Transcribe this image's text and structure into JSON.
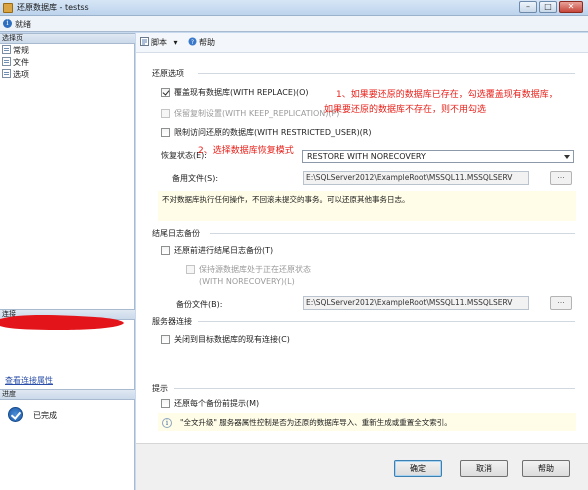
{
  "window": {
    "title": "还原数据库 - testss",
    "controls": [
      "–",
      "□",
      "✕"
    ]
  },
  "status": {
    "text": "就绪"
  },
  "left": {
    "select_page_header": "选择页",
    "pages": [
      "常规",
      "文件",
      "选项"
    ],
    "connection_header": "连接",
    "view_connection_props": "查看连接属性",
    "progress_header": "进度",
    "progress_status": "已完成"
  },
  "toolbar": {
    "script_label": "脚本",
    "help_label": "帮助"
  },
  "restore_options": {
    "header": "还原选项",
    "overwrite": {
      "label": "覆盖现有数据库(WITH REPLACE)(O)",
      "checked": true
    },
    "keep_replication": {
      "label": "保留复制设置(WITH KEEP_REPLICATION)(P)",
      "checked": false,
      "disabled": true
    },
    "restrict_access": {
      "label": "限制访问还原的数据库(WITH RESTRICTED_USER)(R)",
      "checked": false
    },
    "recovery_state_label": "恢复状态(E):",
    "recovery_state_value": "RESTORE WITH NORECOVERY",
    "standby_file_label": "备用文件(S):",
    "standby_file_value": "E:\\SQLServer2012\\ExampleRoot\\MSSQL11.MSSQLSERV",
    "info_text": "不对数据库执行任何操作，不回滚未提交的事务。可以还原其他事务日志。"
  },
  "annotations": {
    "note1_line1": "1、如果要还原的数据库已存在，勾选覆盖现有数据库，",
    "note1_line2": "如果要还原的数据库不存在，则不用勾选",
    "note2": "2、选择数据库恢复模式"
  },
  "tail_log": {
    "header": "结尾日志备份",
    "backup_before": {
      "label": "还原前进行结尾日志备份(T)",
      "checked": false
    },
    "leave_norecovery_line1": "保持源数据库处于正在还原状态",
    "leave_norecovery_line2": "(WITH NORECOVERY)(L)",
    "backup_file_label": "备份文件(B):",
    "backup_file_value": "E:\\SQLServer2012\\ExampleRoot\\MSSQL11.MSSQLSERV"
  },
  "server_connections": {
    "header": "服务器连接",
    "close_existing": {
      "label": "关闭到目标数据库的现有连接(C)",
      "checked": false
    }
  },
  "prompt": {
    "header": "提示",
    "prompt_before_each": {
      "label": "还原每个备份前提示(M)",
      "checked": false
    },
    "fulltext_info": "\"全文升级\" 服务器属性控制是否为还原的数据库导入、重新生成或重置全文索引。"
  },
  "buttons": {
    "ok": "确定",
    "cancel": "取消",
    "help": "帮助"
  },
  "browse_label": "..."
}
